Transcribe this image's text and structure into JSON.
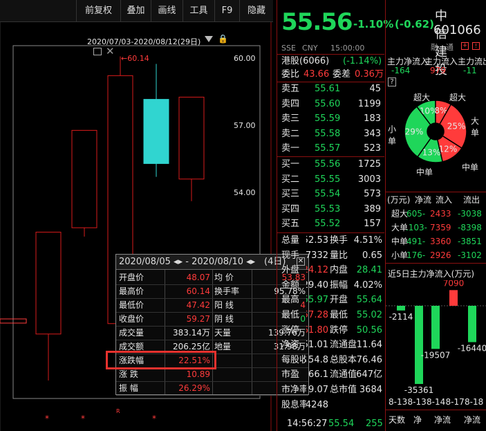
{
  "toolbar": {
    "buttons": [
      "前复权",
      "叠加",
      "画线",
      "工具",
      "F9",
      "隐藏"
    ]
  },
  "chart": {
    "range_label": "2020/07/03-2020/08/12(29日)",
    "max_label": "60.14",
    "price_ticks": [
      "60.00",
      "57.00",
      "54.00"
    ],
    "bottom_marks": [
      "*",
      "*",
      "R",
      "*"
    ],
    "candles": [
      {
        "open": 47.6,
        "high": 49.7,
        "low": 45.5,
        "close": 52.2,
        "color": "red",
        "hollow": true
      },
      {
        "open": 52.4,
        "high": 53.9,
        "low": 52.0,
        "close": 56.8,
        "color": "red",
        "hollow": true
      },
      {
        "open": 48.07,
        "high": 60.14,
        "low": 47.42,
        "close": 59.27,
        "color": "red",
        "hollow": true
      },
      {
        "open": 58.2,
        "high": 59.8,
        "low": 54.7,
        "close": 55.3,
        "color": "cyan",
        "hollow": false
      },
      {
        "open": 54.6,
        "high": 57.7,
        "low": 53.6,
        "close": 58.3,
        "color": "red",
        "hollow": true
      }
    ]
  },
  "quote": {
    "price": "55.56",
    "change_pct": "-1.10%",
    "change": "(-0.62)",
    "name": "中信建投",
    "code": "601066",
    "exchange": "SSE",
    "currency": "CNY",
    "time": "15:00:00",
    "tags": [
      "融",
      "通"
    ]
  },
  "hk": {
    "label": "港股(6066)",
    "pct": "(-1.14%)"
  },
  "weibi": {
    "label": "委比",
    "value": "43.66",
    "label2": "委差",
    "value2": "0.36万"
  },
  "asks": [
    {
      "label": "卖五",
      "price": "55.61",
      "vol": "45"
    },
    {
      "label": "卖四",
      "price": "55.60",
      "vol": "1199"
    },
    {
      "label": "卖三",
      "price": "55.59",
      "vol": "183"
    },
    {
      "label": "卖二",
      "price": "55.58",
      "vol": "343"
    },
    {
      "label": "卖一",
      "price": "55.57",
      "vol": "523"
    }
  ],
  "bids": [
    {
      "label": "买一",
      "price": "55.56",
      "vol": "1725"
    },
    {
      "label": "买二",
      "price": "55.55",
      "vol": "3003"
    },
    {
      "label": "买三",
      "price": "55.54",
      "vol": "573"
    },
    {
      "label": "买四",
      "price": "55.53",
      "vol": "389"
    },
    {
      "label": "买五",
      "price": "55.52",
      "vol": "157"
    }
  ],
  "stats": [
    {
      "l1": "总量",
      "v1": "52.53",
      "l2": "换手",
      "v2": "4.51%"
    },
    {
      "l1": "现手",
      "v1": "7332",
      "l2": "量比",
      "v2": "0.65"
    },
    {
      "l1": "外盘",
      "v1": "24.12",
      "l2": "内盘",
      "v2": "28.41"
    },
    {
      "l1": "金额",
      "v1": "29.40",
      "l2": "振幅",
      "v2": "4.02%"
    },
    {
      "l1": "最高",
      "v1": "55.97",
      "l2": "开盘",
      "v2": "55.64"
    },
    {
      "l1": "最低",
      "v1": "57.28",
      "l2": "最低",
      "v2": "55.02"
    },
    {
      "l1": "涨停",
      "v1": "61.80",
      "l2": "跌停",
      "v2": "50.56"
    },
    {
      "l1": "净资",
      "v1": "51.01",
      "l2": "流通盘",
      "v2": "11.64"
    },
    {
      "l1": "每股收益",
      "v1": "54.8",
      "l2": "总股本",
      "v2": "76.46"
    },
    {
      "l1": "市盈",
      "v1": "66.1",
      "l2": "流通值",
      "v2": "647亿"
    },
    {
      "l1": "市净率",
      "v1": "9.07",
      "l2": "总市值",
      "v2": "3684"
    },
    {
      "l1": "股息率",
      "v1": "4248",
      "l2": "",
      "v2": ""
    }
  ],
  "bottom_time": {
    "time": "14:56:27",
    "price": "55.54",
    "vol": "255"
  },
  "fund": {
    "header": [
      "主力净流入",
      "主力流入",
      "主力流出"
    ],
    "values": [
      "-164",
      "979",
      "-11"
    ],
    "pie": {
      "labels": [
        "超大",
        "超大",
        "大单",
        "中单",
        "中单",
        "小单"
      ],
      "pcts": [
        {
          "label": "10%",
          "value": 10,
          "color": "#1fd65a"
        },
        {
          "label": "8%",
          "value": 8,
          "color": "#ff3b3b"
        },
        {
          "label": "25%",
          "value": 25,
          "color": "#ff3b3b"
        },
        {
          "label": "12%",
          "value": 12,
          "color": "#ff3b3b"
        },
        {
          "label": "13%",
          "value": 13,
          "color": "#1fd65a"
        },
        {
          "label": "29%",
          "value": 29,
          "color": "#1fd65a"
        }
      ]
    },
    "table_header": [
      "(万元)",
      "净流",
      "流入",
      "流出"
    ],
    "table": [
      {
        "label": "超大",
        "net": "-605",
        "in": "2433",
        "out": "-3038"
      },
      {
        "label": "大单",
        "net": "-1103",
        "in": "7359",
        "out": "-8398"
      },
      {
        "label": "中单",
        "net": "-491",
        "in": "3360",
        "out": "-3851"
      },
      {
        "label": "小单",
        "net": "-176",
        "in": "2926",
        "out": "-3102"
      }
    ],
    "five_day_title": "近5日主力净流入(万元)",
    "bars": [
      {
        "value": -2114,
        "label": "-2114"
      },
      {
        "value": -35361,
        "label": "-35361"
      },
      {
        "value": -19507,
        "label": "-19507"
      },
      {
        "value": 7090,
        "label": "7090"
      },
      {
        "value": -16440,
        "label": "-16440"
      }
    ],
    "dates": [
      "8-13",
      "8-13",
      "8-14",
      "8-17",
      "8-18"
    ],
    "footer": [
      "天数",
      "净",
      "净流",
      "净流"
    ]
  },
  "popup": {
    "header": "2020/08/05 ◂▸ - 2020/08/10 ◂▸",
    "days": "(4日)",
    "rows": [
      {
        "l1": "开盘价",
        "v1": "48.07",
        "l2": "均  价",
        "v2": "53.83",
        "c1": "red",
        "c2": "red"
      },
      {
        "l1": "最高价",
        "v1": "60.14",
        "l2": "换手率",
        "v2": "95.78%",
        "c1": "red",
        "c2": "white"
      },
      {
        "l1": "最低价",
        "v1": "47.42",
        "l2": "阳  线",
        "v2": "4",
        "c1": "red",
        "c2": "red"
      },
      {
        "l1": "收盘价",
        "v1": "59.27",
        "l2": "阴  线",
        "v2": "0",
        "c1": "red",
        "c2": "green"
      },
      {
        "l1": "成交量",
        "v1": "383.14万",
        "l2": "天量",
        "v2": "139.76万",
        "c1": "white",
        "c2": "white"
      },
      {
        "l1": "成交额",
        "v1": "206.25亿",
        "l2": "地量",
        "v2": "31.98万",
        "c1": "white",
        "c2": "white"
      },
      {
        "l1": "涨跌幅",
        "v1": "22.51%",
        "l2": "",
        "v2": "",
        "c1": "red",
        "c2": "white"
      },
      {
        "l1": "涨  跌",
        "v1": "10.89",
        "l2": "",
        "v2": "",
        "c1": "red",
        "c2": "white"
      },
      {
        "l1": "振  幅",
        "v1": "26.29%",
        "l2": "",
        "v2": "",
        "c1": "red",
        "c2": "white"
      }
    ]
  }
}
